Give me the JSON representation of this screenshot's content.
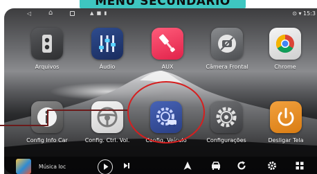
{
  "banner": {
    "text": "MENU SECUNDÁRIO"
  },
  "status_bar": {
    "time": "15:3",
    "right_icons": [
      "location-icon",
      "wifi-icon"
    ]
  },
  "apps": [
    {
      "label": "Arquivos",
      "icon": "file-manager-icon"
    },
    {
      "label": "Áudio",
      "icon": "equalizer-icon"
    },
    {
      "label": "AUX",
      "icon": "aux-cable-icon"
    },
    {
      "label": "Câmera Frontal",
      "icon": "camera-icon"
    },
    {
      "label": "Chrome",
      "icon": "chrome-icon"
    },
    {
      "label": "Config Info Car",
      "icon": "info-icon"
    },
    {
      "label": "Config. Ctrl. Vol.",
      "icon": "steering-wheel-icon"
    },
    {
      "label": "Config. Veículo",
      "icon": "vehicle-settings-icon"
    },
    {
      "label": "Configurações",
      "icon": "gear-icon"
    },
    {
      "label": "Desligar Tela",
      "icon": "power-icon"
    }
  ],
  "dock": {
    "music_title": "Música loc",
    "buttons": [
      "play-icon",
      "next-icon",
      "navigation-icon",
      "car-icon",
      "refresh-icon",
      "settings-icon",
      "apps-grid-icon"
    ]
  },
  "colors": {
    "banner": "#3ec6c0",
    "highlight": "#d61f1f",
    "aux": "#e1224a",
    "vehicle": "#2a3f84",
    "power": "#d97c12"
  }
}
